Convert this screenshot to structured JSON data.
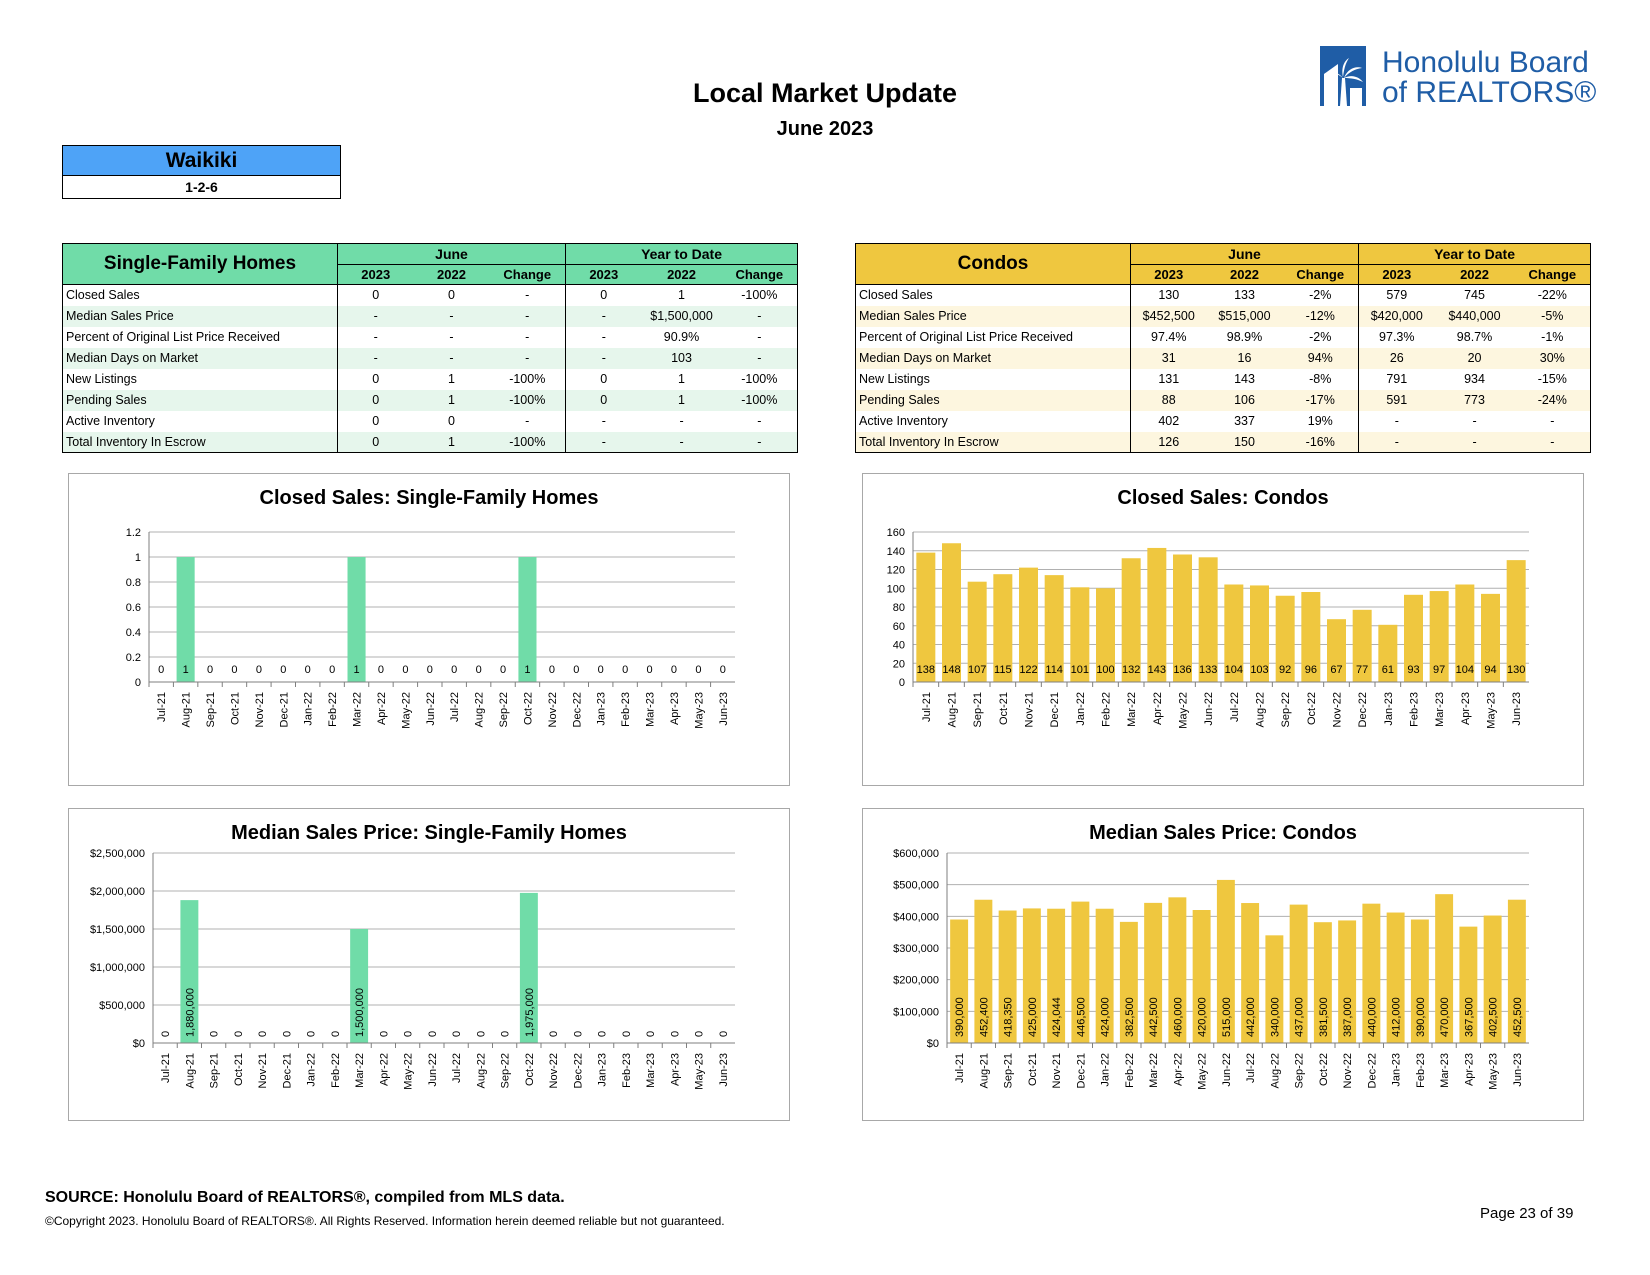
{
  "header": {
    "title": "Local Market Update",
    "subtitle": "June 2023",
    "logo_text_line1": "Honolulu Board",
    "logo_text_line2": "of REALTORS®"
  },
  "area": {
    "name": "Waikiki",
    "code": "1-2-6"
  },
  "tables": {
    "group_june": "June",
    "group_ytd": "Year to Date",
    "col_headers": [
      "2023",
      "2022",
      "Change",
      "2023",
      "2022",
      "Change"
    ],
    "single_family": {
      "title": "Single-Family Homes",
      "rows": [
        [
          "Closed Sales",
          "0",
          "0",
          "-",
          "0",
          "1",
          "-100%"
        ],
        [
          "Median Sales Price",
          "-",
          "-",
          "-",
          "-",
          "$1,500,000",
          "-"
        ],
        [
          "Percent of Original List Price Received",
          "-",
          "-",
          "-",
          "-",
          "90.9%",
          "-"
        ],
        [
          "Median Days on Market",
          "-",
          "-",
          "-",
          "-",
          "103",
          "-"
        ],
        [
          "New Listings",
          "0",
          "1",
          "-100%",
          "0",
          "1",
          "-100%"
        ],
        [
          "Pending Sales",
          "0",
          "1",
          "-100%",
          "0",
          "1",
          "-100%"
        ],
        [
          "Active Inventory",
          "0",
          "0",
          "-",
          "-",
          "-",
          "-"
        ],
        [
          "Total Inventory In Escrow",
          "0",
          "1",
          "-100%",
          "-",
          "-",
          "-"
        ]
      ]
    },
    "condos": {
      "title": "Condos",
      "rows": [
        [
          "Closed Sales",
          "130",
          "133",
          "-2%",
          "579",
          "745",
          "-22%"
        ],
        [
          "Median Sales Price",
          "$452,500",
          "$515,000",
          "-12%",
          "$420,000",
          "$440,000",
          "-5%"
        ],
        [
          "Percent of Original List Price Received",
          "97.4%",
          "98.9%",
          "-2%",
          "97.3%",
          "98.7%",
          "-1%"
        ],
        [
          "Median Days on Market",
          "31",
          "16",
          "94%",
          "26",
          "20",
          "30%"
        ],
        [
          "New Listings",
          "131",
          "143",
          "-8%",
          "791",
          "934",
          "-15%"
        ],
        [
          "Pending Sales",
          "88",
          "106",
          "-17%",
          "591",
          "773",
          "-24%"
        ],
        [
          "Active Inventory",
          "402",
          "337",
          "19%",
          "-",
          "-",
          "-"
        ],
        [
          "Total Inventory In Escrow",
          "126",
          "150",
          "-16%",
          "-",
          "-",
          "-"
        ]
      ]
    }
  },
  "chart_data": [
    {
      "id": "sf-closed",
      "type": "bar",
      "title": "Closed Sales: Single-Family Homes",
      "categories": [
        "Jul-21",
        "Aug-21",
        "Sep-21",
        "Oct-21",
        "Nov-21",
        "Dec-21",
        "Jan-22",
        "Feb-22",
        "Mar-22",
        "Apr-22",
        "May-22",
        "Jun-22",
        "Jul-22",
        "Aug-22",
        "Sep-22",
        "Oct-22",
        "Nov-22",
        "Dec-22",
        "Jan-23",
        "Feb-23",
        "Mar-23",
        "Apr-23",
        "May-23",
        "Jun-23"
      ],
      "values": [
        0,
        1,
        0,
        0,
        0,
        0,
        0,
        0,
        1,
        0,
        0,
        0,
        0,
        0,
        0,
        1,
        0,
        0,
        0,
        0,
        0,
        0,
        0,
        0
      ],
      "data_labels": [
        "0",
        "1",
        "0",
        "0",
        "0",
        "0",
        "0",
        "0",
        "1",
        "0",
        "0",
        "0",
        "0",
        "0",
        "0",
        "1",
        "0",
        "0",
        "0",
        "0",
        "0",
        "0",
        "0",
        "0"
      ],
      "y_ticks": [
        0,
        0.2,
        0.4,
        0.6,
        0.8,
        1,
        1.2
      ],
      "y_tick_labels": [
        "0",
        "0.2",
        "0.4",
        "0.6",
        "0.8",
        "1",
        "1.2"
      ],
      "ylim": [
        0,
        1.2
      ],
      "color": "#70dca8",
      "grid": true
    },
    {
      "id": "co-closed",
      "type": "bar",
      "title": "Closed Sales: Condos",
      "categories": [
        "Jul-21",
        "Aug-21",
        "Sep-21",
        "Oct-21",
        "Nov-21",
        "Dec-21",
        "Jan-22",
        "Feb-22",
        "Mar-22",
        "Apr-22",
        "May-22",
        "Jun-22",
        "Jul-22",
        "Aug-22",
        "Sep-22",
        "Oct-22",
        "Nov-22",
        "Dec-22",
        "Jan-23",
        "Feb-23",
        "Mar-23",
        "Apr-23",
        "May-23",
        "Jun-23"
      ],
      "values": [
        138,
        148,
        107,
        115,
        122,
        114,
        101,
        100,
        132,
        143,
        136,
        133,
        104,
        103,
        92,
        96,
        67,
        77,
        61,
        93,
        97,
        104,
        94,
        130
      ],
      "data_labels": [
        "138",
        "148",
        "107",
        "115",
        "122",
        "114",
        "101",
        "100",
        "132",
        "143",
        "136",
        "133",
        "104",
        "103",
        "92",
        "96",
        "67",
        "77",
        "61",
        "93",
        "97",
        "104",
        "94",
        "130"
      ],
      "y_ticks": [
        0,
        20,
        40,
        60,
        80,
        100,
        120,
        140,
        160
      ],
      "y_tick_labels": [
        "0",
        "20",
        "40",
        "60",
        "80",
        "100",
        "120",
        "140",
        "160"
      ],
      "ylim": [
        0,
        160
      ],
      "color": "#efc73f",
      "grid": true
    },
    {
      "id": "sf-price",
      "type": "bar",
      "title": "Median Sales Price: Single-Family Homes",
      "categories": [
        "Jul-21",
        "Aug-21",
        "Sep-21",
        "Oct-21",
        "Nov-21",
        "Dec-21",
        "Jan-22",
        "Feb-22",
        "Mar-22",
        "Apr-22",
        "May-22",
        "Jun-22",
        "Jul-22",
        "Aug-22",
        "Sep-22",
        "Oct-22",
        "Nov-22",
        "Dec-22",
        "Jan-23",
        "Feb-23",
        "Mar-23",
        "Apr-23",
        "May-23",
        "Jun-23"
      ],
      "values": [
        0,
        1880000,
        0,
        0,
        0,
        0,
        0,
        0,
        1500000,
        0,
        0,
        0,
        0,
        0,
        0,
        1975000,
        0,
        0,
        0,
        0,
        0,
        0,
        0,
        0
      ],
      "data_labels": [
        "0",
        "1,880,000",
        "0",
        "0",
        "0",
        "0",
        "0",
        "0",
        "1,500,000",
        "0",
        "0",
        "0",
        "0",
        "0",
        "0",
        "1,975,000",
        "0",
        "0",
        "0",
        "0",
        "0",
        "0",
        "0",
        "0"
      ],
      "y_ticks": [
        0,
        500000,
        1000000,
        1500000,
        2000000,
        2500000
      ],
      "y_tick_labels": [
        "$0",
        "$500,000",
        "$1,000,000",
        "$1,500,000",
        "$2,000,000",
        "$2,500,000"
      ],
      "ylim": [
        0,
        2500000
      ],
      "color": "#70dca8",
      "grid": true
    },
    {
      "id": "co-price",
      "type": "bar",
      "title": "Median Sales Price: Condos",
      "categories": [
        "Jul-21",
        "Aug-21",
        "Sep-21",
        "Oct-21",
        "Nov-21",
        "Dec-21",
        "Jan-22",
        "Feb-22",
        "Mar-22",
        "Apr-22",
        "May-22",
        "Jun-22",
        "Jul-22",
        "Aug-22",
        "Sep-22",
        "Oct-22",
        "Nov-22",
        "Dec-22",
        "Jan-23",
        "Feb-23",
        "Mar-23",
        "Apr-23",
        "May-23",
        "Jun-23"
      ],
      "values": [
        390000,
        452400,
        418350,
        425000,
        424044,
        446500,
        424000,
        382500,
        442500,
        460000,
        420000,
        515000,
        442000,
        340000,
        437000,
        381500,
        387000,
        440000,
        412000,
        390000,
        470000,
        367500,
        402500,
        452500
      ],
      "data_labels": [
        "390,000",
        "452,400",
        "418,350",
        "425,000",
        "424,044",
        "446,500",
        "424,000",
        "382,500",
        "442,500",
        "460,000",
        "420,000",
        "515,000",
        "442,000",
        "340,000",
        "437,000",
        "381,500",
        "387,000",
        "440,000",
        "412,000",
        "390,000",
        "470,000",
        "367,500",
        "402,500",
        "452,500"
      ],
      "y_ticks": [
        0,
        100000,
        200000,
        300000,
        400000,
        500000,
        600000
      ],
      "y_tick_labels": [
        "$0",
        "$100,000",
        "$200,000",
        "$300,000",
        "$400,000",
        "$500,000",
        "$600,000"
      ],
      "ylim": [
        0,
        600000
      ],
      "color": "#efc73f",
      "grid": true
    }
  ],
  "footer": {
    "source": "SOURCE: Honolulu Board of REALTORS®, compiled from MLS data.",
    "copyright": "©Copyright 2023. Honolulu Board of REALTORS®. All Rights Reserved. Information herein deemed reliable but not guaranteed.",
    "page": "Page 23 of 39"
  }
}
